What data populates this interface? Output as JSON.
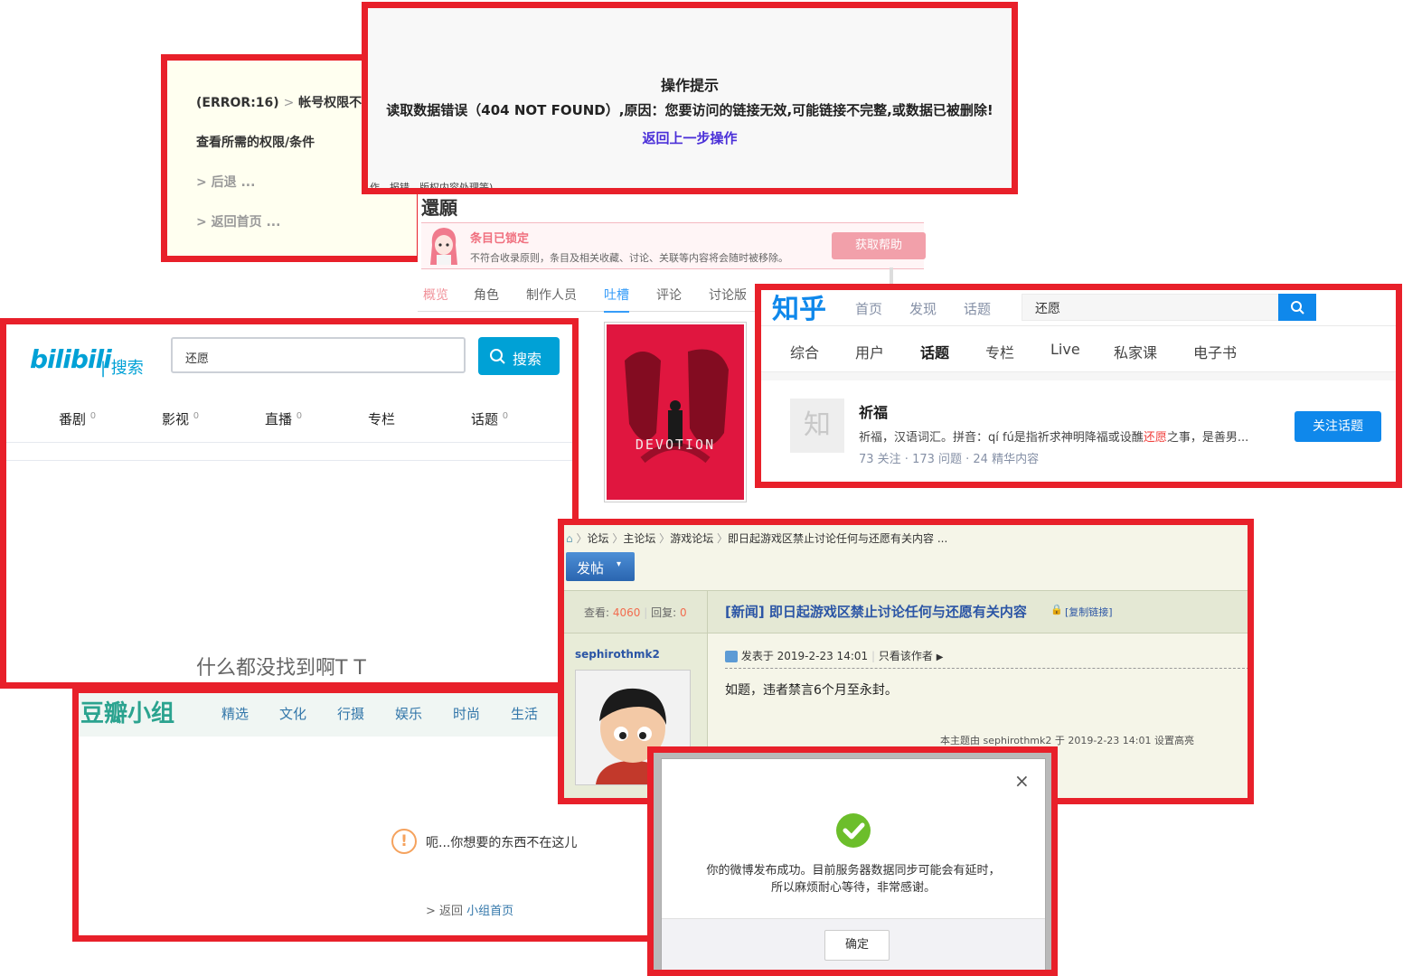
{
  "error_panel": {
    "code": "(ERROR:16)",
    "sep": ">",
    "message": "帐号权限不足",
    "view_perm": "查看所需的权限/条件",
    "back": "> 后退 ...",
    "home": "> 返回首页 ..."
  },
  "tip_panel": {
    "title": "操作提示",
    "message": "读取数据错误（404 NOT FOUND）,原因：您要访问的链接无效,可能链接不完整,或数据已被删除!",
    "back_link": "返回上一步操作",
    "footer_fragment": "作、报错、版权内容处理等)"
  },
  "subject_panel": {
    "title": "還願",
    "locked_title": "条目已锁定",
    "locked_desc": "不符合收录原则，条目及相关收藏、讨论、关联等内容将会随时被移除。",
    "help_button": "获取帮助",
    "tabs": [
      "概览",
      "角色",
      "制作人员",
      "吐槽",
      "评论",
      "讨论版"
    ],
    "active_tab_index": 3,
    "cover_text": "DEVOTION",
    "cover_color": "#e0163f"
  },
  "zhihu": {
    "logo": "知乎",
    "nav": [
      "首页",
      "发现",
      "话题"
    ],
    "search_value": "还愿",
    "tabs": [
      "综合",
      "用户",
      "话题",
      "专栏",
      "Live",
      "私家课",
      "电子书"
    ],
    "active_tab_index": 2,
    "result": {
      "avatar_char": "知",
      "title": "祈福",
      "desc_before": "祈福，汉语词汇。拼音：qí fú是指祈求神明降福或设醮",
      "desc_highlight": "还愿",
      "desc_after": "之事，是善男...",
      "stats": "73 关注 · 173 问题 · 24 精华内容",
      "follow_button": "关注话题"
    },
    "brand_color": "#0f88eb"
  },
  "bilibili": {
    "logo": "bilibili",
    "logo_suffix": "| 搜索",
    "search_value": "还愿",
    "search_button": "搜索",
    "tabs": [
      {
        "label": "番剧",
        "count": "0"
      },
      {
        "label": "影视",
        "count": "0"
      },
      {
        "label": "直播",
        "count": "0"
      },
      {
        "label": "专栏",
        "count": ""
      },
      {
        "label": "话题",
        "count": "0"
      }
    ],
    "empty_text": "什么都没找到啊T T",
    "brand_color": "#00a1d6"
  },
  "douban": {
    "logo": "豆瓣小组",
    "nav": [
      "精选",
      "文化",
      "行摄",
      "娱乐",
      "时尚",
      "生活"
    ],
    "message": "呃...你想要的东西不在这儿",
    "back_prefix": "> 返回",
    "back_link": "小组首页",
    "brand_color": "#2ba38f"
  },
  "forum": {
    "breadcrumb": [
      "论坛",
      "主论坛",
      "游戏论坛",
      "即日起游戏区禁止讨论任何与还愿有关内容 ..."
    ],
    "post_button": "发帖",
    "views_label": "查看:",
    "views": "4060",
    "replies_label": "回复:",
    "replies": "0",
    "thread_title": "[新闻] 即日起游戏区禁止讨论任何与还愿有关内容",
    "copy_link": "[复制链接]",
    "author": "sephirothmk2",
    "posted_at": "发表于 2019-2-23 14:01",
    "only_author": "只看该作者",
    "content": "如题，违者禁言6个月至永封。",
    "highlight_note": "本主题由 sephirothmk2 于 2019-2-23 14:01 设置高亮"
  },
  "weibo_dialog": {
    "message": "你的微博发布成功。目前服务器数据同步可能会有延时，所以麻烦耐心等待，非常感谢。",
    "confirm_button": "确定",
    "close": "×"
  }
}
